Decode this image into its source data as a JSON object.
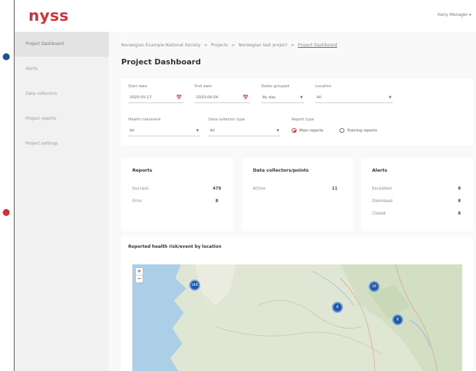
{
  "brand": {
    "logo_text": "nyss",
    "accent": "#d4303a",
    "marker_blue": "#1e5aa8"
  },
  "topbar": {
    "user_label": "Hany Menager ▾"
  },
  "sidebar": {
    "items": [
      {
        "label": "Project Dashboard",
        "active": true
      },
      {
        "label": "Alerts"
      },
      {
        "label": "Data collectors"
      },
      {
        "label": "Project reports"
      },
      {
        "label": "Project settings"
      }
    ]
  },
  "breadcrumb": [
    "Norwegian Example National Society",
    "Projects",
    "Norwegian test project",
    "Project Dashboard"
  ],
  "breadcrumb_sep": ">",
  "page_title": "Project Dashboard",
  "filters": {
    "start_date": {
      "label": "Start date",
      "value": "2020-05-17",
      "icon": "calendar-icon"
    },
    "end_date": {
      "label": "End date",
      "value": "2020-06-04",
      "icon": "calendar-icon"
    },
    "dates_grouped": {
      "label": "Dates grouped",
      "value": "By day"
    },
    "location": {
      "label": "Location",
      "value": "All"
    },
    "health_risk": {
      "label": "Health risk/event",
      "value": "All"
    },
    "dc_type": {
      "label": "Data collector type",
      "value": "All"
    },
    "report_type": {
      "label": "Report type",
      "options": [
        "Main reports",
        "Training reports"
      ],
      "selected": 0
    }
  },
  "cards": {
    "reports": {
      "title": "Reports",
      "rows": [
        {
          "label": "Success",
          "value": "479"
        },
        {
          "label": "Error",
          "value": "8"
        }
      ]
    },
    "data_collectors": {
      "title": "Data collectors/points",
      "rows": [
        {
          "label": "Active",
          "value": "11"
        }
      ]
    },
    "alerts": {
      "title": "Alerts",
      "rows": [
        {
          "label": "Escalated",
          "value": "8"
        },
        {
          "label": "Dismissed",
          "value": "8"
        },
        {
          "label": "Closed",
          "value": "8"
        }
      ]
    }
  },
  "map": {
    "title": "Reported health risk/event by location",
    "zoom_in": "+",
    "zoom_out": "−",
    "markers": [
      "166",
      "8",
      "16",
      "8"
    ]
  }
}
